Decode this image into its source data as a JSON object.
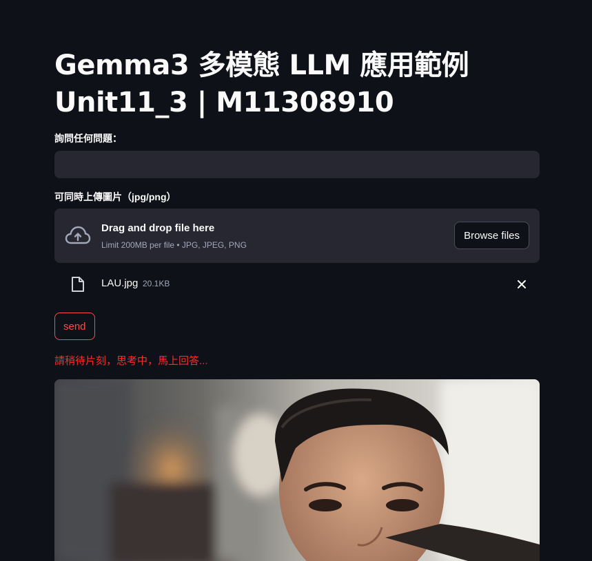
{
  "header": {
    "title_line1": "Gemma3 多模態 LLM 應用範例",
    "title_line2": "Unit11_3 | M11308910"
  },
  "question": {
    "label": "詢問任何問題：",
    "value": ""
  },
  "uploader": {
    "label": "可同時上傳圖片（jpg/png）",
    "drop_text": "Drag and drop file here",
    "limit_text": "Limit 200MB per file • JPG, JPEG, PNG",
    "browse_label": "Browse files",
    "file": {
      "name": "LAU.jpg",
      "size": "20.1KB"
    }
  },
  "actions": {
    "send_label": "send"
  },
  "status": {
    "message": "請稍待片刻，思考中，馬上回答..."
  },
  "colors": {
    "background": "#0e1117",
    "surface": "#262730",
    "accent": "#ff4b4b",
    "status": "#ff2b2b"
  },
  "icons": {
    "upload": "cloud-upload-icon",
    "file": "file-icon",
    "remove": "close-icon"
  }
}
